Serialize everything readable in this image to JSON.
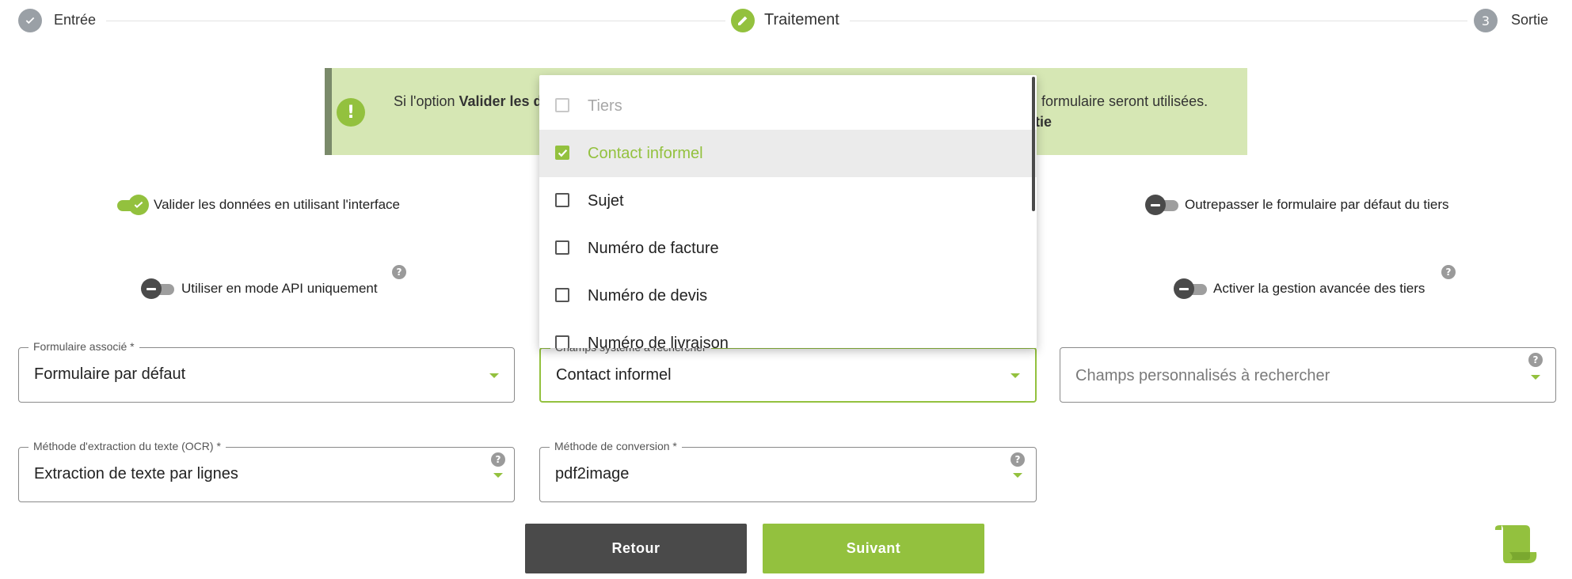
{
  "colors": {
    "accent": "#93c13e",
    "dark": "#4a4a4a",
    "banner_bg": "#d6e7b4"
  },
  "stepper": {
    "steps": [
      {
        "label": "Entrée",
        "state": "done",
        "icon": "check-icon"
      },
      {
        "label": "Traitement",
        "state": "active",
        "icon": "pencil-icon"
      },
      {
        "label": "Sortie",
        "state": "pending",
        "number": "3"
      }
    ]
  },
  "banner": {
    "icon": "exclamation-icon",
    "line1_prefix": "Si l'option ",
    "line1_bold": "Valider les d",
    "line1_suffix": "u formulaire seront utilisées.",
    "line2_bold": "rtie"
  },
  "toggles": {
    "validate_ui": {
      "label": "Valider les données en utilisant l'interface",
      "on": true
    },
    "override_form": {
      "label": "Outrepasser le formulaire par défaut du tiers",
      "on": false
    },
    "api_only": {
      "label": "Utiliser en mode API uniquement",
      "on": false
    },
    "advanced_tiers": {
      "label": "Activer la gestion avancée des tiers",
      "on": false
    }
  },
  "fields": {
    "form": {
      "label": "Formulaire associé *",
      "value": "Formulaire par défaut"
    },
    "system_fields": {
      "label": "Champs système à rechercher",
      "value": "Contact informel"
    },
    "custom_fields": {
      "placeholder": "Champs personnalisés à rechercher"
    },
    "ocr": {
      "label": "Méthode d'extraction du texte (OCR) *",
      "value": "Extraction de texte par lignes"
    },
    "conversion": {
      "label": "Méthode de conversion *",
      "value": "pdf2image"
    }
  },
  "help_glyph": "?",
  "dropdown": {
    "options": [
      {
        "label": "Tiers",
        "checked": false,
        "disabled": true
      },
      {
        "label": "Contact informel",
        "checked": true,
        "disabled": false
      },
      {
        "label": "Sujet",
        "checked": false,
        "disabled": false
      },
      {
        "label": "Numéro de facture",
        "checked": false,
        "disabled": false
      },
      {
        "label": "Numéro de devis",
        "checked": false,
        "disabled": false
      },
      {
        "label": "Numéro de livraison",
        "checked": false,
        "disabled": false
      }
    ]
  },
  "buttons": {
    "back": "Retour",
    "next": "Suivant"
  },
  "footer": {
    "icon": "scroll-icon"
  }
}
